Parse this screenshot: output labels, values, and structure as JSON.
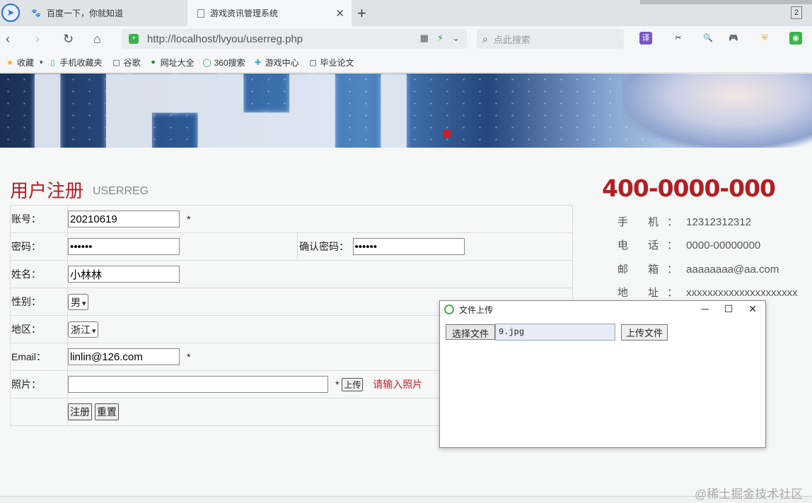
{
  "tabs": [
    {
      "title": "百度一下，你就知道",
      "active": false
    },
    {
      "title": "游戏资讯管理系统",
      "active": true
    }
  ],
  "tab_count": "2",
  "address_bar": {
    "url": "http://localhost/lvyou/userreg.php"
  },
  "search": {
    "placeholder": "点此搜索"
  },
  "bookmarks": [
    "收藏",
    "手机收藏夹",
    "谷歌",
    "网址大全",
    "360搜索",
    "游戏中心",
    "毕业论文"
  ],
  "page": {
    "title": "用户注册",
    "subtitle": "USERREG",
    "hotline": "400-0000-000",
    "contact": [
      {
        "key": "手 机：",
        "value": "12312312312"
      },
      {
        "key": "电 话：",
        "value": "0000-00000000"
      },
      {
        "key": "邮 箱：",
        "value": "aaaaaaaa@aa.com"
      },
      {
        "key": "地 址：",
        "value": "xxxxxxxxxxxxxxxxxxxxx"
      }
    ]
  },
  "form": {
    "account_label": "账号：",
    "account_value": "20210619",
    "required_mark": "*",
    "password_label": "密码：",
    "password_value": "••••••",
    "confirm_label": "确认密码：",
    "confirm_value": "••••••",
    "name_label": "姓名：",
    "name_value": "小林林",
    "gender_label": "性别：",
    "gender_value": "男",
    "region_label": "地区：",
    "region_value": "浙江",
    "email_label": "Email：",
    "email_value": "linlin@126.com",
    "photo_label": "照片：",
    "photo_value": "",
    "upload_label": "上传",
    "photo_error": "请输入照片",
    "submit_label": "注册",
    "reset_label": "重置"
  },
  "dialog": {
    "title": "文件上传",
    "choose_label": "选择文件",
    "file_name": "9.jpg",
    "upload_label": "上传文件"
  },
  "watermark": "@稀土掘金技术社区"
}
